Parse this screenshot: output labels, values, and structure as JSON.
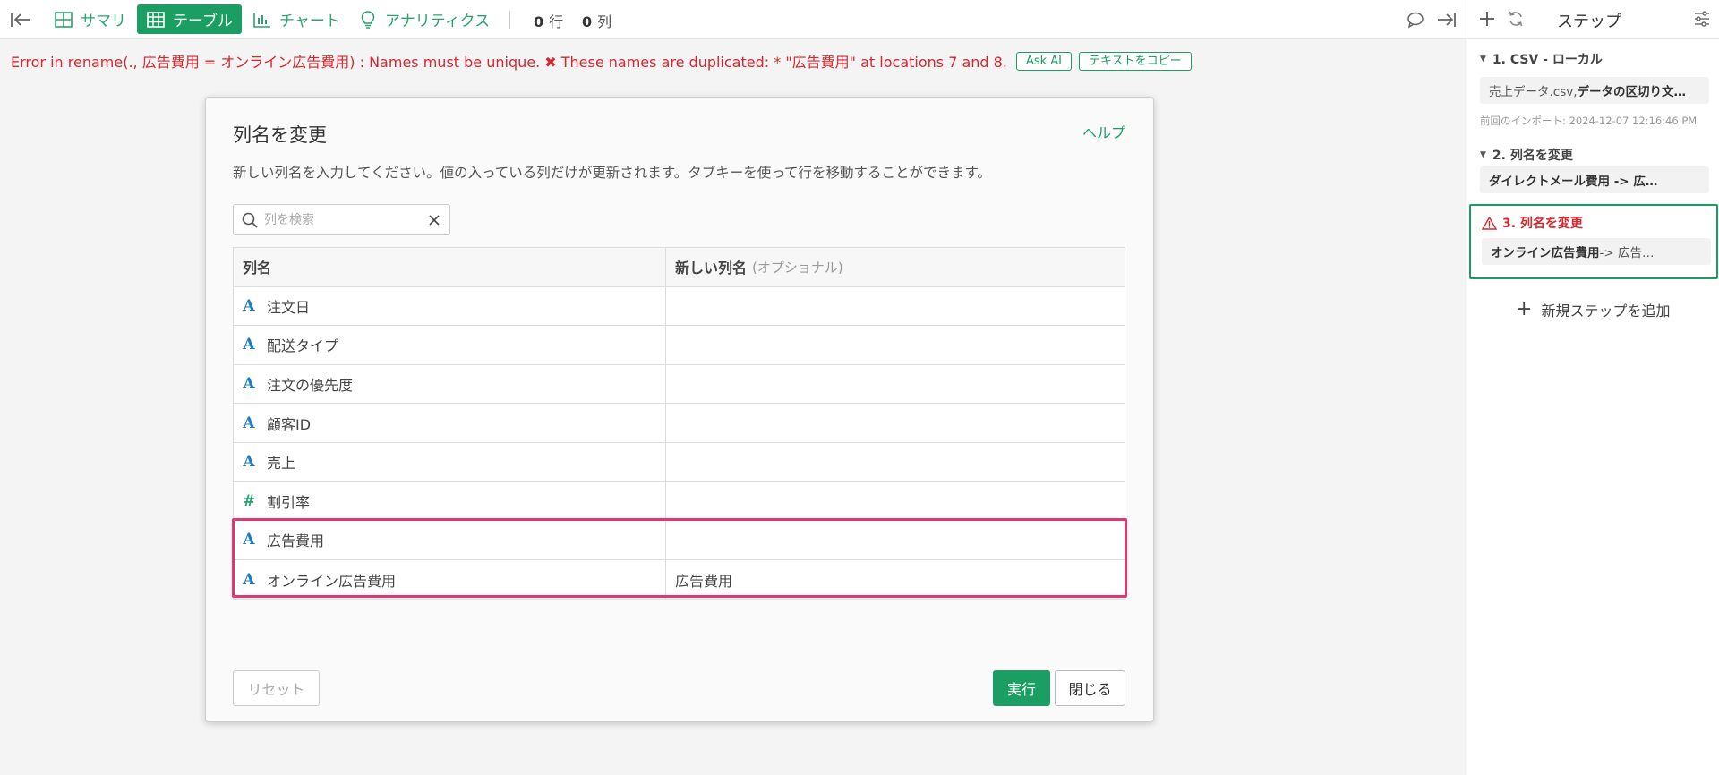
{
  "toolbar": {
    "tabs": [
      {
        "label": "サマリ",
        "icon": "summary-grid-icon"
      },
      {
        "label": "テーブル",
        "icon": "table-icon"
      },
      {
        "label": "チャート",
        "icon": "chart-icon"
      },
      {
        "label": "アナリティクス",
        "icon": "lightbulb-icon"
      }
    ],
    "rows_count": "0",
    "rows_unit": "行",
    "cols_count": "0",
    "cols_unit": "列"
  },
  "error": {
    "message": "Error in rename(., 広告費用 = オンライン広告費用) : Names must be unique. ✖ These names are duplicated: * \"広告費用\" at locations 7 and 8.",
    "ask_ai_label": "Ask AI",
    "copy_label": "テキストをコピー"
  },
  "dialog": {
    "title": "列名を変更",
    "help_label": "ヘルプ",
    "description": "新しい列名を入力してください。値の入っている列だけが更新されます。タブキーを使って行を移動することができます。",
    "search": {
      "placeholder": "列を検索",
      "value": ""
    },
    "columns": {
      "name": "列名",
      "new_name": "新しい列名",
      "optional": "(オプショナル)"
    },
    "rows": [
      {
        "type": "text",
        "icon": "A",
        "name": "注文日",
        "new_name": ""
      },
      {
        "type": "text",
        "icon": "A",
        "name": "配送タイプ",
        "new_name": ""
      },
      {
        "type": "text",
        "icon": "A",
        "name": "注文の優先度",
        "new_name": ""
      },
      {
        "type": "text",
        "icon": "A",
        "name": "顧客ID",
        "new_name": ""
      },
      {
        "type": "text",
        "icon": "A",
        "name": "売上",
        "new_name": ""
      },
      {
        "type": "number",
        "icon": "#",
        "name": "割引率",
        "new_name": ""
      },
      {
        "type": "text",
        "icon": "A",
        "name": "広告費用",
        "new_name": ""
      },
      {
        "type": "text",
        "icon": "A",
        "name": "オンライン広告費用",
        "new_name": "広告費用"
      }
    ],
    "reset_label": "リセット",
    "run_label": "実行",
    "close_label": "閉じる"
  },
  "steps_panel": {
    "title": "ステップ",
    "steps": [
      {
        "title": "1. CSV - ローカル",
        "chip_light": "売上データ.csv, ",
        "chip_bold": "データの区切り文…",
        "meta": "前回のインポート: 2024-12-07 12:16:46 PM"
      },
      {
        "title": "2. 列名を変更",
        "chip_light": "",
        "chip_bold": "ダイレクトメール費用 -> 広…",
        "meta": ""
      },
      {
        "title": "3. 列名を変更",
        "chip_light": " -> 広告…",
        "chip_bold": "オンライン広告費用",
        "meta": "",
        "status": "error"
      }
    ],
    "add_step_label": "新規ステップを追加"
  },
  "colors": {
    "accent": "#1a9e62",
    "error": "#d9262e",
    "highlight": "#e5356f"
  }
}
